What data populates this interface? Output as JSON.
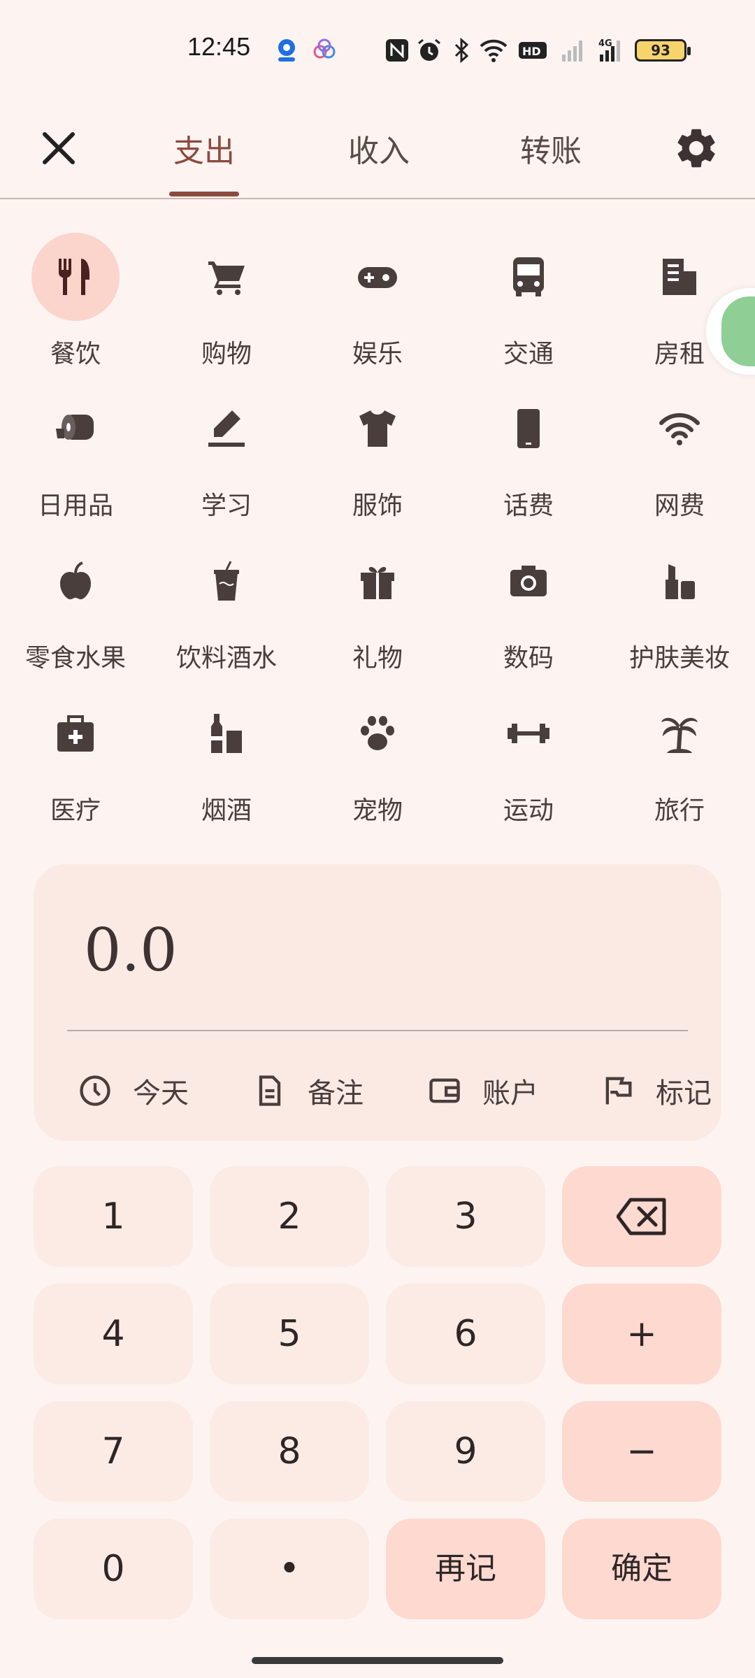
{
  "status_bar": {
    "time": "12:45",
    "icons": [
      "app-notification-icon",
      "app-notification-icon-2",
      "nfc-icon",
      "alarm-icon",
      "bluetooth-icon",
      "wifi-icon",
      "hd-icon",
      "signal-icon",
      "4g-signal-icon"
    ],
    "battery": "93"
  },
  "header": {
    "tabs": [
      {
        "label": "支出",
        "active": true
      },
      {
        "label": "收入",
        "active": false
      },
      {
        "label": "转账",
        "active": false
      }
    ]
  },
  "categories": [
    {
      "label": "餐饮",
      "icon": "utensils-icon",
      "selected": true
    },
    {
      "label": "购物",
      "icon": "shopping-cart-icon"
    },
    {
      "label": "娱乐",
      "icon": "gamepad-icon"
    },
    {
      "label": "交通",
      "icon": "bus-icon"
    },
    {
      "label": "房租",
      "icon": "building-icon"
    },
    {
      "label": "日用品",
      "icon": "toilet-paper-icon"
    },
    {
      "label": "学习",
      "icon": "pen-icon"
    },
    {
      "label": "服饰",
      "icon": "tshirt-icon"
    },
    {
      "label": "话费",
      "icon": "phone-icon"
    },
    {
      "label": "网费",
      "icon": "wifi-icon"
    },
    {
      "label": "零食水果",
      "icon": "apple-icon"
    },
    {
      "label": "饮料酒水",
      "icon": "cup-icon"
    },
    {
      "label": "礼物",
      "icon": "gift-icon"
    },
    {
      "label": "数码",
      "icon": "camera-icon"
    },
    {
      "label": "护肤美妆",
      "icon": "lipstick-icon"
    },
    {
      "label": "医疗",
      "icon": "medkit-icon"
    },
    {
      "label": "烟酒",
      "icon": "bottle-icon"
    },
    {
      "label": "宠物",
      "icon": "paw-icon"
    },
    {
      "label": "运动",
      "icon": "dumbbell-icon"
    },
    {
      "label": "旅行",
      "icon": "palm-tree-icon"
    }
  ],
  "amount": {
    "value": "0.0",
    "meta": [
      {
        "label": "今天",
        "icon": "clock-icon"
      },
      {
        "label": "备注",
        "icon": "document-icon"
      },
      {
        "label": "账户",
        "icon": "wallet-icon"
      },
      {
        "label": "标记",
        "icon": "flag-icon"
      }
    ]
  },
  "keypad": {
    "k1": "1",
    "k2": "2",
    "k3": "3",
    "k4": "4",
    "k5": "5",
    "k6": "6",
    "k7": "7",
    "k8": "8",
    "k9": "9",
    "k0": "0",
    "dot": "•",
    "plus": "+",
    "minus": "−",
    "again": "再记",
    "confirm": "确定"
  },
  "colors": {
    "background": "#FDF4F1",
    "accent": "#8C4A3E",
    "icon": "#4A3E3C",
    "selected_bg": "#FBD4CC",
    "key_bg": "#FCEAE5",
    "key_op_bg": "#FDD9D0"
  }
}
